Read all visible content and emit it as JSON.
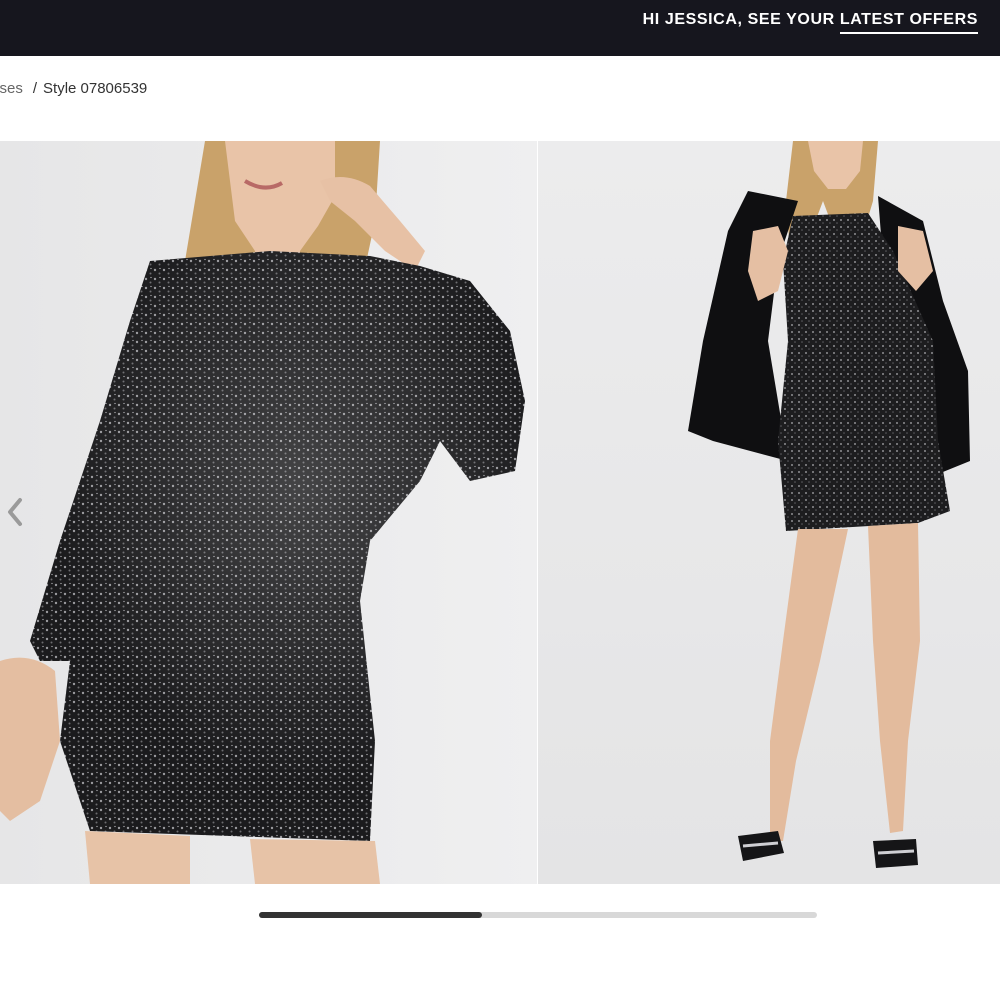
{
  "header": {
    "greeting": "HI JESSICA, SEE YOUR ",
    "offers_link": "LATEST OFFERS"
  },
  "breadcrumb": {
    "previous": "sses",
    "current": "Style 07806539"
  },
  "gallery": {
    "images": [
      {
        "description": "front",
        "icon": "product-photo-closeup"
      },
      {
        "description": "full length with blazer",
        "icon": "product-photo-full"
      }
    ],
    "scroll_fraction": 0.4
  },
  "colors": {
    "topbar": "#16161e",
    "photo_bg": "#e9e9ea",
    "dress": "#1c1c1e"
  }
}
